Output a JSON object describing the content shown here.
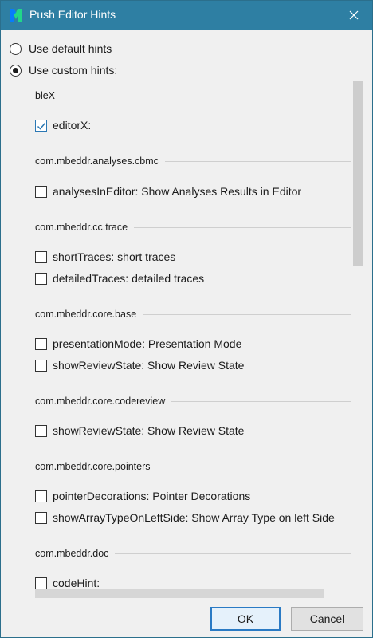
{
  "window": {
    "title": "Push Editor Hints"
  },
  "options": {
    "default_label": "Use default hints",
    "custom_label": "Use custom hints:",
    "selected": "custom"
  },
  "groups": [
    {
      "label": "bleX",
      "items": [
        {
          "label": "editorX:",
          "checked": true
        }
      ]
    },
    {
      "label": "com.mbeddr.analyses.cbmc",
      "items": [
        {
          "label": "analysesInEditor: Show Analyses Results in Editor",
          "checked": false
        }
      ]
    },
    {
      "label": "com.mbeddr.cc.trace",
      "items": [
        {
          "label": "shortTraces: short traces",
          "checked": false
        },
        {
          "label": "detailedTraces: detailed traces",
          "checked": false
        }
      ]
    },
    {
      "label": "com.mbeddr.core.base",
      "items": [
        {
          "label": "presentationMode: Presentation Mode",
          "checked": false
        },
        {
          "label": "showReviewState: Show Review State",
          "checked": false
        }
      ]
    },
    {
      "label": "com.mbeddr.core.codereview",
      "items": [
        {
          "label": "showReviewState: Show Review State",
          "checked": false
        }
      ]
    },
    {
      "label": "com.mbeddr.core.pointers",
      "items": [
        {
          "label": "pointerDecorations: Pointer Decorations",
          "checked": false
        },
        {
          "label": "showArrayTypeOnLeftSide: Show Array Type on left Side",
          "checked": false
        }
      ]
    },
    {
      "label": "com.mbeddr.doc",
      "items": [
        {
          "label": "codeHint:",
          "checked": false
        }
      ]
    }
  ],
  "buttons": {
    "ok": "OK",
    "cancel": "Cancel"
  },
  "icons": {
    "app": "jetbrains-mps-icon",
    "close": "close-icon",
    "check": "checkmark-icon"
  },
  "colors": {
    "titlebar": "#2e7fa3",
    "accent": "#2a7ac4"
  }
}
